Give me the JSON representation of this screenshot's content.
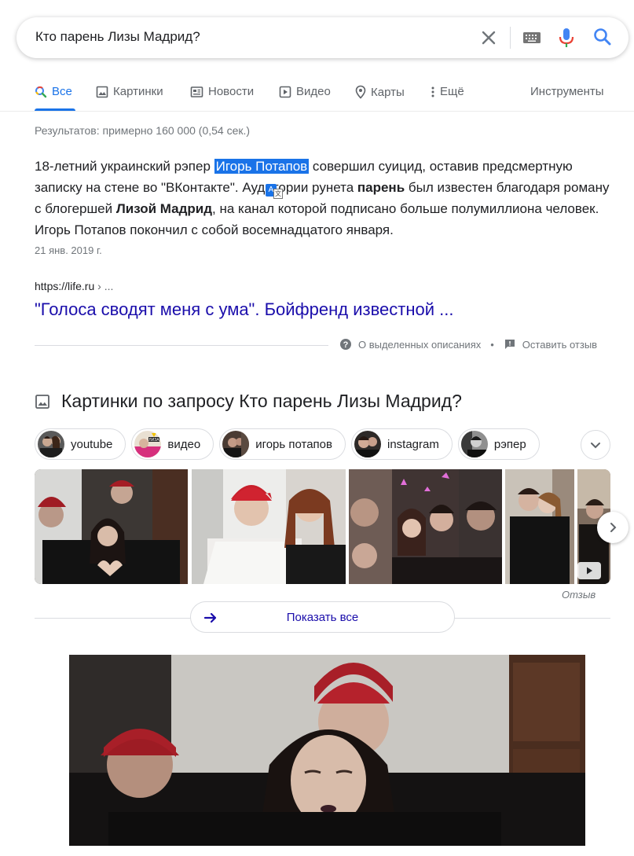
{
  "search": {
    "query": "Кто парень Лизы Мадрид?"
  },
  "tabs": [
    {
      "label": "Все",
      "icon": "search-icon",
      "active": true
    },
    {
      "label": "Картинки",
      "icon": "image-icon"
    },
    {
      "label": "Новости",
      "icon": "news-icon"
    },
    {
      "label": "Видео",
      "icon": "play-icon"
    },
    {
      "label": "Карты",
      "icon": "map-pin-icon"
    },
    {
      "label": "Ещё",
      "icon": "more-vert-icon"
    }
  ],
  "tools_label": "Инструменты",
  "stats": "Результатов: примерно 160 000 (0,54 сек.)",
  "snippet": {
    "p1": "18-летний украинский рэпер ",
    "highlight": "Игорь Потапов",
    "p2": " совершил суицид, оставив предсмертную записку на стене во \"ВКонтакте\". Ау",
    "p3": "дитории рунета ",
    "bold1": "парень",
    "p4": " был известен благодаря роману с блогершей ",
    "bold2": "Лизой Мадрид",
    "p5": ", на канал которой подписано больше полумиллиона человек. Игорь Потапов покончил с собой восемнадцатого января.",
    "date": "21 янв. 2019 г."
  },
  "source": {
    "url": "https://life.ru",
    "crumb": " › ...",
    "title": "\"Голоса сводят меня с ума\". Бойфренд известной ..."
  },
  "featured_footer": {
    "about": "О выделенных описаниях",
    "feedback": "Оставить отзыв"
  },
  "images": {
    "heading": "Картинки по запросу Кто парень Лизы Мадрид?",
    "chips": [
      "youtube",
      "видео",
      "игорь потапов",
      "instagram",
      "рэпер"
    ],
    "feedback": "Отзыв",
    "show_all": "Показать все"
  },
  "colors": {
    "accent": "#1a73e8",
    "link": "#1a0dab",
    "muted": "#70757a"
  }
}
